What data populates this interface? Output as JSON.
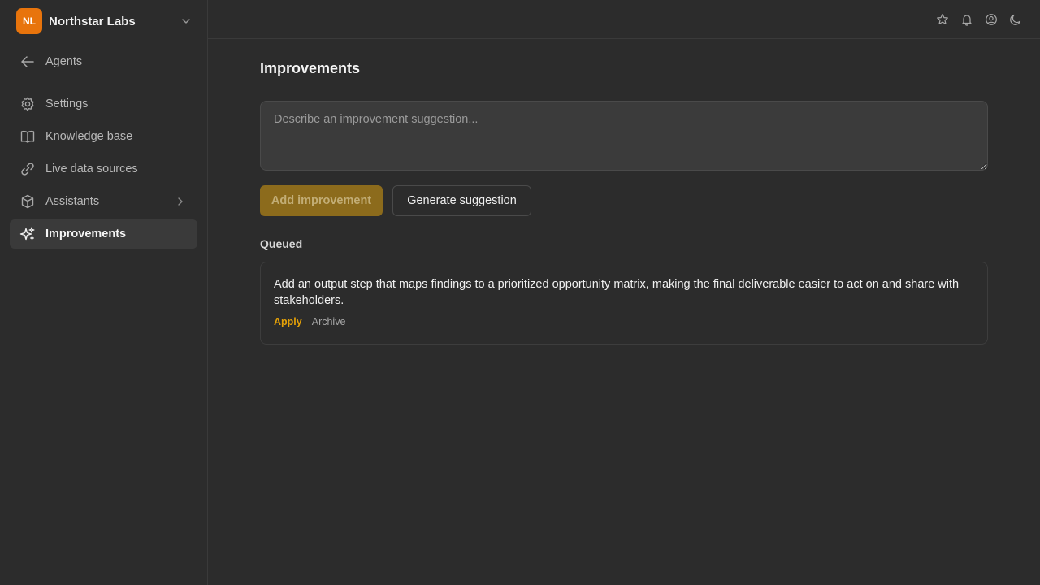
{
  "org": {
    "initials": "NL",
    "name": "Northstar Labs",
    "avatar_color": "#e8740c"
  },
  "sidebar": {
    "back": {
      "label": "Agents",
      "icon": "arrow-left-icon"
    },
    "items": [
      {
        "label": "Settings",
        "icon": "gear-icon"
      },
      {
        "label": "Knowledge base",
        "icon": "book-icon"
      },
      {
        "label": "Live data sources",
        "icon": "link-icon"
      },
      {
        "label": "Assistants",
        "icon": "cube-icon",
        "has_submenu": true
      },
      {
        "label": "Improvements",
        "icon": "sparkles-icon",
        "active": true
      }
    ]
  },
  "topbar": {
    "icons": [
      "star-icon",
      "bell-icon",
      "user-circle-icon",
      "moon-icon"
    ]
  },
  "main": {
    "title": "Improvements",
    "input_placeholder": "Describe an improvement suggestion...",
    "add_button": "Add improvement",
    "generate_button": "Generate suggestion",
    "queued_label": "Queued",
    "queued_items": [
      {
        "text": "Add an output step that maps findings to a prioritized opportunity matrix, making the final deliverable easier to act on and share with stakeholders.",
        "apply_label": "Apply",
        "archive_label": "Archive"
      }
    ]
  },
  "colors": {
    "accent": "#e3a008",
    "primary_button_bg": "#8c6b1c",
    "background": "#2c2c2c",
    "active_nav_bg": "#3a3a3a"
  }
}
